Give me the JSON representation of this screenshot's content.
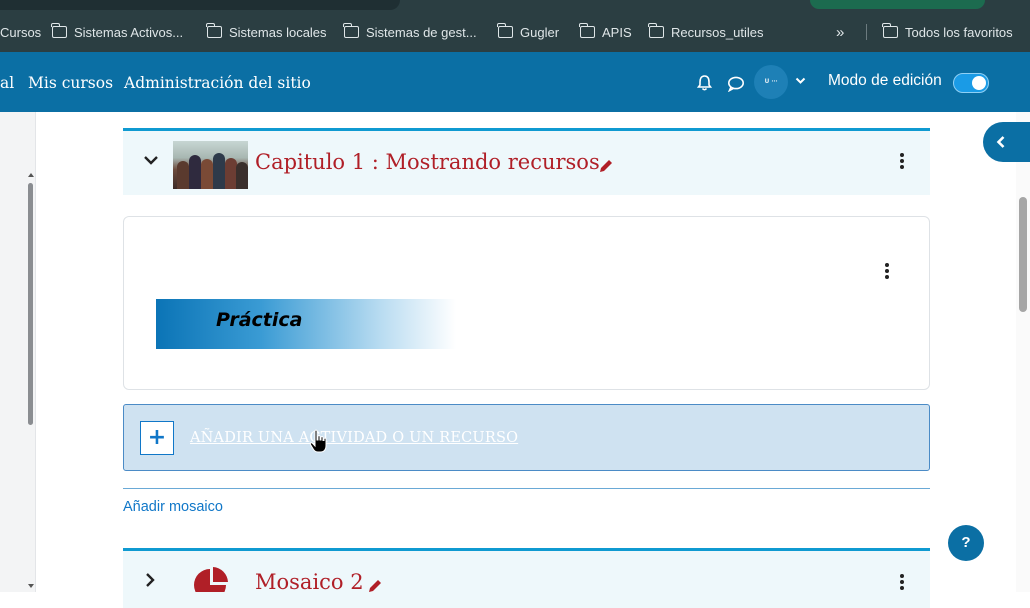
{
  "bookmarks": {
    "items": [
      {
        "label": "Cursos",
        "icon": "folder-icon"
      },
      {
        "label": "Sistemas Activos...",
        "icon": "folder-icon"
      },
      {
        "label": "Sistemas locales",
        "icon": "folder-icon"
      },
      {
        "label": "Sistemas de gest...",
        "icon": "folder-icon"
      },
      {
        "label": "Gugler",
        "icon": "folder-icon"
      },
      {
        "label": "APIS",
        "icon": "folder-icon"
      },
      {
        "label": "Recursos_utiles",
        "icon": "folder-icon"
      }
    ],
    "overflow_label": "»",
    "all_bookmarks": "Todos los favoritos"
  },
  "navbar": {
    "links": [
      "al",
      "Mis cursos",
      "Administración del sitio"
    ],
    "edit_mode_label": "Modo de edición",
    "edit_mode_on": true,
    "brand_color": "#0b6fa4"
  },
  "sections": [
    {
      "title": "Capitulo 1 : Mostrando recursos",
      "expanded": true
    },
    {
      "title": "Mosaico 2",
      "expanded": false
    }
  ],
  "activity": {
    "banner_text": "Práctica"
  },
  "add_activity_label": "AÑADIR UNA ACTIVIDAD O UN RECURSO",
  "add_mosaic_label": "Añadir mosaico",
  "help_label": "?",
  "colors": {
    "accent": "#0f9ad1",
    "section_title": "#b01f27",
    "link": "#1077c8"
  }
}
